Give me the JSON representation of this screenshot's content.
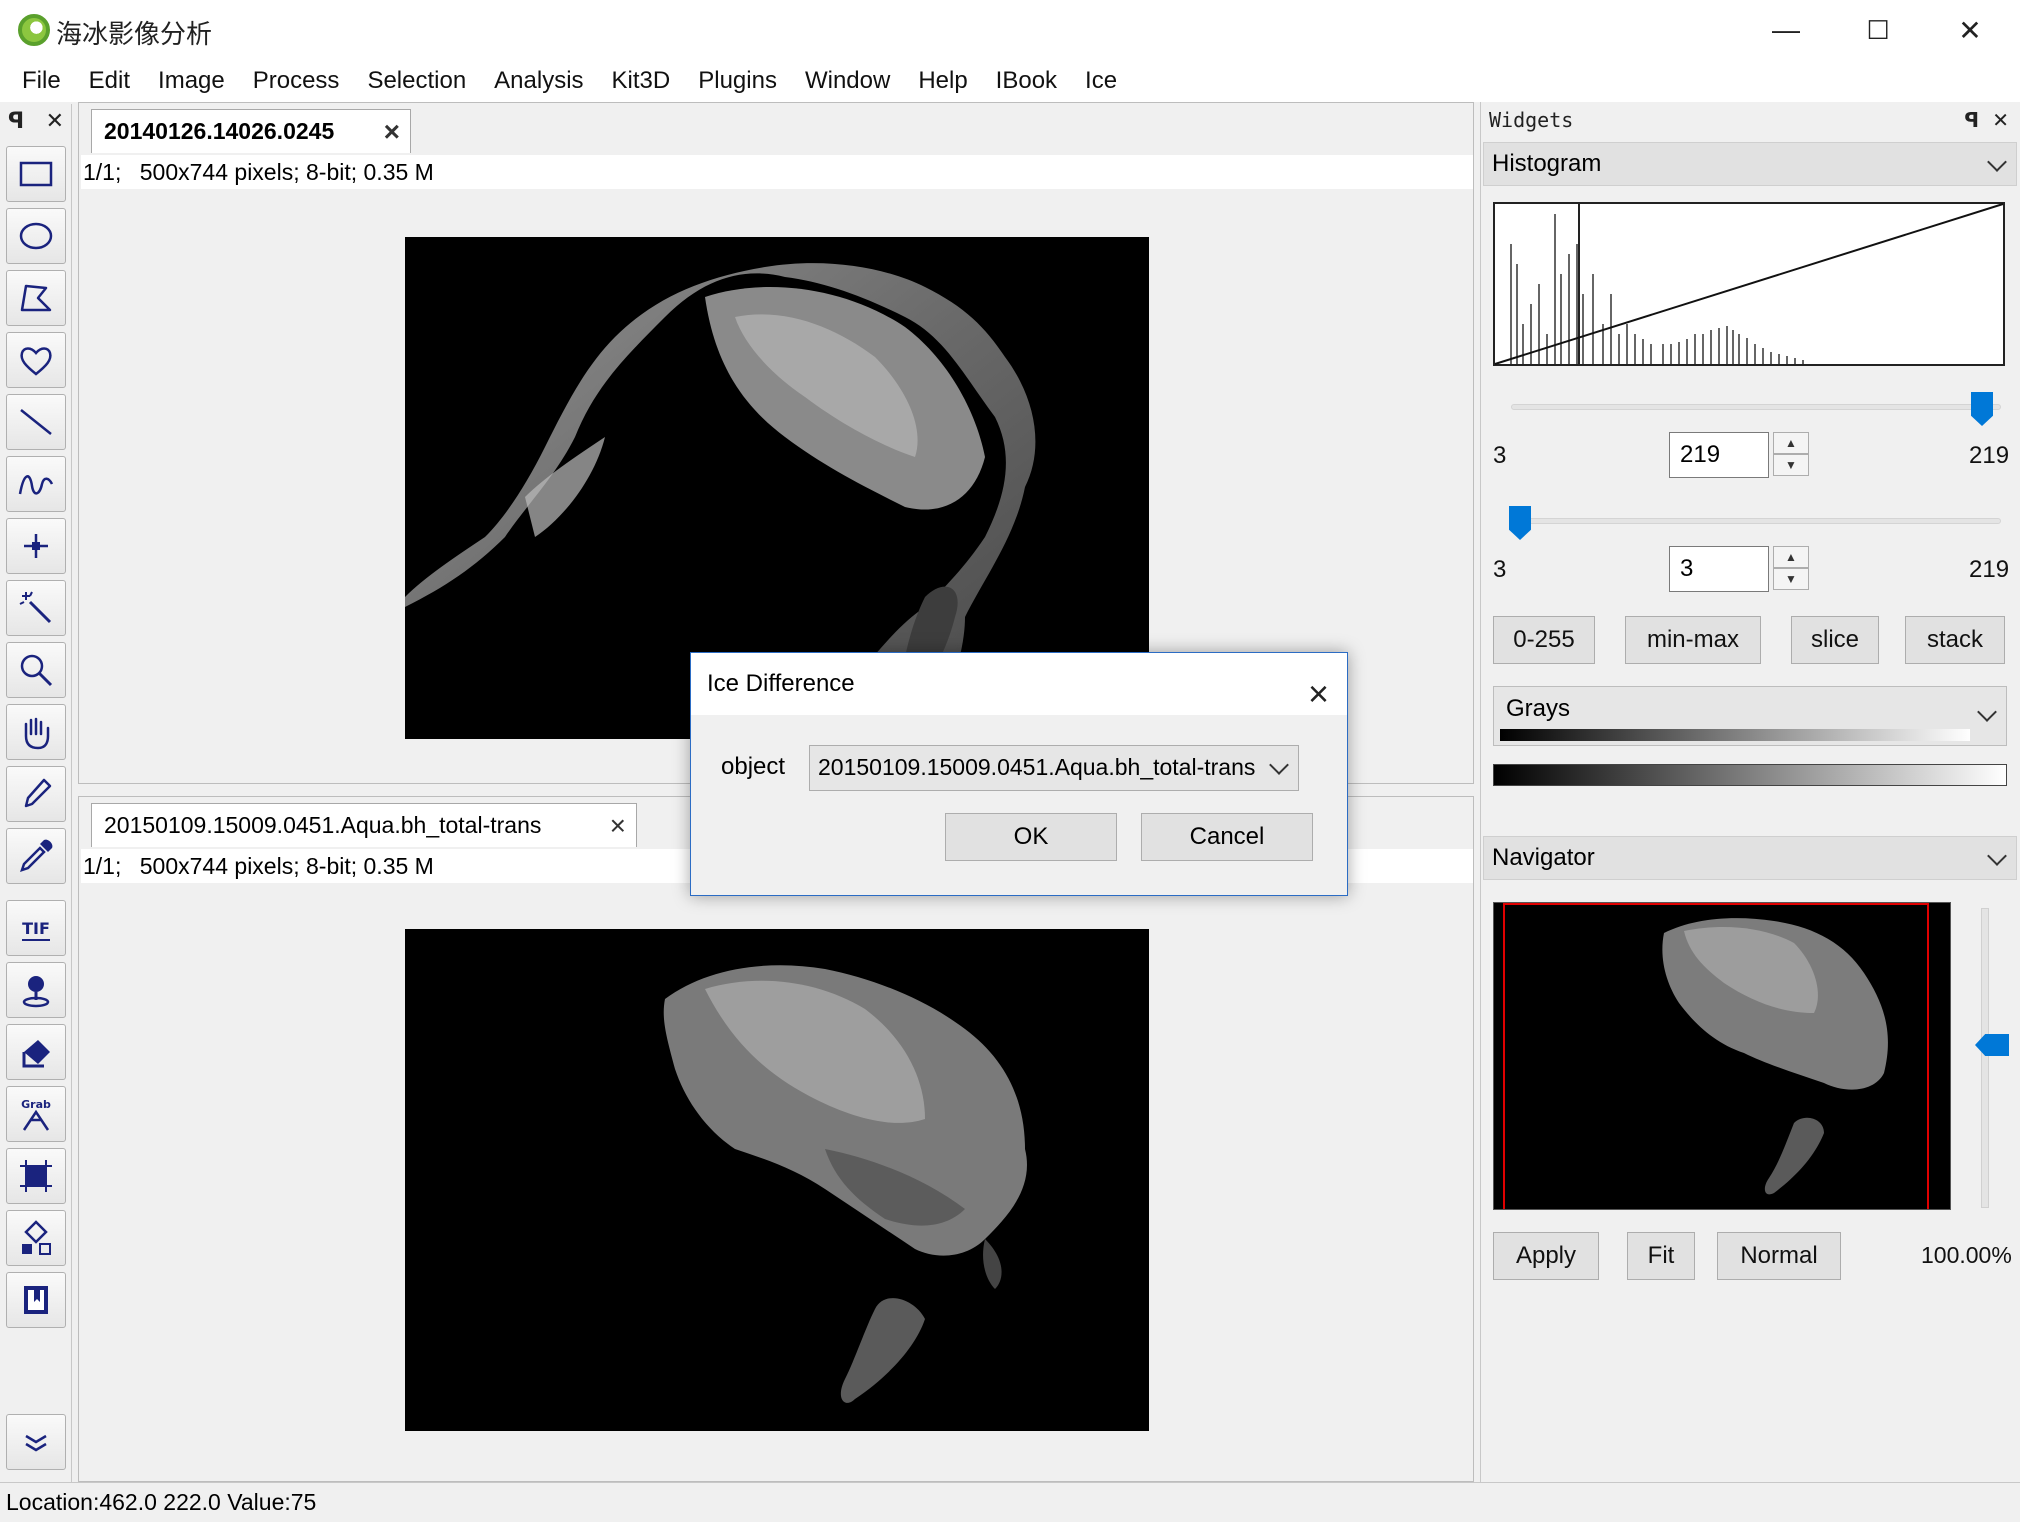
{
  "window": {
    "title": "海冰影像分析",
    "minimize_glyph": "—",
    "maximize_glyph": "☐",
    "close_glyph": "✕"
  },
  "menu": [
    "File",
    "Edit",
    "Image",
    "Process",
    "Selection",
    "Analysis",
    "Kit3D",
    "Plugins",
    "Window",
    "Help",
    "IBook",
    "Ice"
  ],
  "toolbar": {
    "pin_glyph": "ꟼ",
    "close_glyph": "✕",
    "tools": [
      "rectangle-icon",
      "oval-icon",
      "polygon-icon",
      "freehand-icon",
      "line-icon",
      "curve-icon",
      "point-icon",
      "wand-icon",
      "zoom-icon",
      "hand-icon",
      "pencil-icon",
      "dropper-icon",
      "tif-icon",
      "map-pin-icon",
      "bucket-icon",
      "grab-icon",
      "crop-icon",
      "shapes-icon",
      "book-icon",
      "more-icon"
    ],
    "tif_label": "TIF",
    "grab_label": "Grab"
  },
  "doc1": {
    "tab_title": "20140126.14026.0245",
    "info_index": "1/1;",
    "info_details": "500x744 pixels; 8-bit; 0.35 M"
  },
  "doc2": {
    "tab_title": "20150109.15009.0451.Aqua.bh_total-trans",
    "info_index": "1/1;",
    "info_details": "500x744 pixels; 8-bit; 0.35 M"
  },
  "widgets": {
    "title": "Widgets",
    "histogram": {
      "section_label": "Histogram",
      "max_slider_value": 219,
      "min_slider_value": 3,
      "max_left": "3",
      "max_input": "219",
      "max_right": "219",
      "min_left": "3",
      "min_input": "3",
      "min_right": "219",
      "buttons": [
        "0-255",
        "min-max",
        "slice",
        "stack"
      ]
    },
    "lut": {
      "selected": "Grays"
    },
    "navigator": {
      "section_label": "Navigator",
      "buttons": [
        "Apply",
        "Fit",
        "Normal"
      ],
      "zoom": "100.00%"
    }
  },
  "status": {
    "text": "Location:462.0 222.0  Value:75"
  },
  "dialog": {
    "title": "Ice Difference",
    "field_label": "object",
    "selected_value": "20150109.15009.0451.Aqua.bh_total-trans",
    "ok_label": "OK",
    "cancel_label": "Cancel"
  },
  "colors": {
    "accent": "#0078d7",
    "tool_icon": "#1a237e",
    "navigator_frame": "#e00000"
  }
}
